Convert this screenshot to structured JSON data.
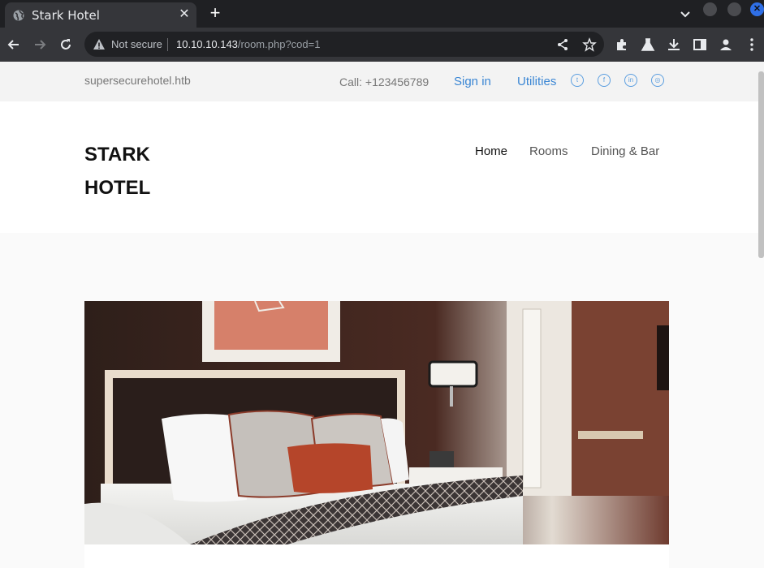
{
  "browser": {
    "tab_title": "Stark Hotel",
    "security_label": "Not secure",
    "url_host": "10.10.10.143",
    "url_path": "/room.php?cod=1"
  },
  "topbar": {
    "domain": "supersecurehotel.htb",
    "phone": "Call: +123456789",
    "signin_label": "Sign in",
    "utilities_label": "Utilities",
    "social_icons": [
      "twitter-icon",
      "facebook-icon",
      "linkedin-icon",
      "dribbble-icon"
    ]
  },
  "header": {
    "brand_line1": "STARK",
    "brand_line2": "HOTEL",
    "nav": [
      "Home",
      "Rooms",
      "Dining & Bar"
    ],
    "active_nav": "Home"
  },
  "colors": {
    "link": "#3a86d4",
    "chrome_dark": "#1f2023",
    "chrome_toolbar": "#35363a"
  }
}
